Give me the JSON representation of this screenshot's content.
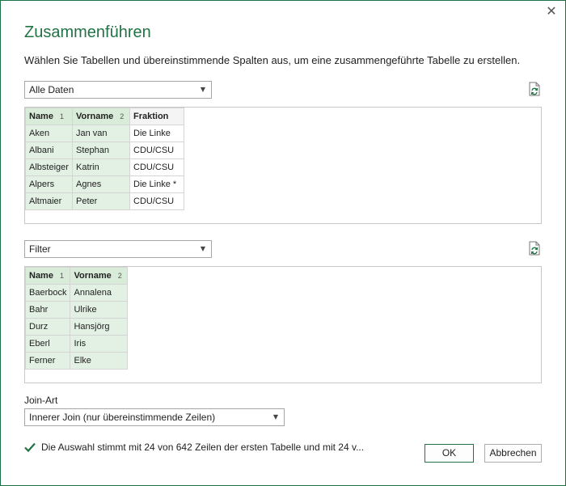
{
  "dialog": {
    "title": "Zusammenführen",
    "subtitle": "Wählen Sie Tabellen und übereinstimmende Spalten aus, um eine zusammengeführte Tabelle zu erstellen.",
    "close_glyph": "✕"
  },
  "table1": {
    "selector_value": "Alle Daten",
    "columns": [
      {
        "label": "Name",
        "badge": "1"
      },
      {
        "label": "Vorname",
        "badge": "2"
      },
      {
        "label": "Fraktion",
        "badge": ""
      }
    ],
    "rows": [
      [
        "Aken",
        "Jan van",
        "Die Linke"
      ],
      [
        "Albani",
        "Stephan",
        "CDU/CSU"
      ],
      [
        "Albsteiger",
        "Katrin",
        "CDU/CSU"
      ],
      [
        "Alpers",
        "Agnes",
        "Die Linke *"
      ],
      [
        "Altmaier",
        "Peter",
        "CDU/CSU"
      ]
    ]
  },
  "table2": {
    "selector_value": "Filter",
    "columns": [
      {
        "label": "Name",
        "badge": "1"
      },
      {
        "label": "Vorname",
        "badge": "2"
      }
    ],
    "rows": [
      [
        "Baerbock",
        "Annalena"
      ],
      [
        "Bahr",
        "Ulrike"
      ],
      [
        "Durz",
        "Hansjörg"
      ],
      [
        "Eberl",
        "Iris"
      ],
      [
        "Ferner",
        "Elke"
      ]
    ]
  },
  "join": {
    "label": "Join-Art",
    "value": "Innerer Join (nur übereinstimmende Zeilen)"
  },
  "status": {
    "text": "Die Auswahl stimmt mit 24 von 642 Zeilen der ersten Tabelle und mit 24 v..."
  },
  "buttons": {
    "ok": "OK",
    "cancel": "Abbrechen"
  },
  "colors": {
    "accent": "#217346",
    "selected_header": "#d8ecd9",
    "selected_cell": "#e2f1e3"
  },
  "icons": {
    "close": "close-icon",
    "refresh": "refresh-icon",
    "caret": "chevron-down-icon",
    "check": "check-icon"
  }
}
